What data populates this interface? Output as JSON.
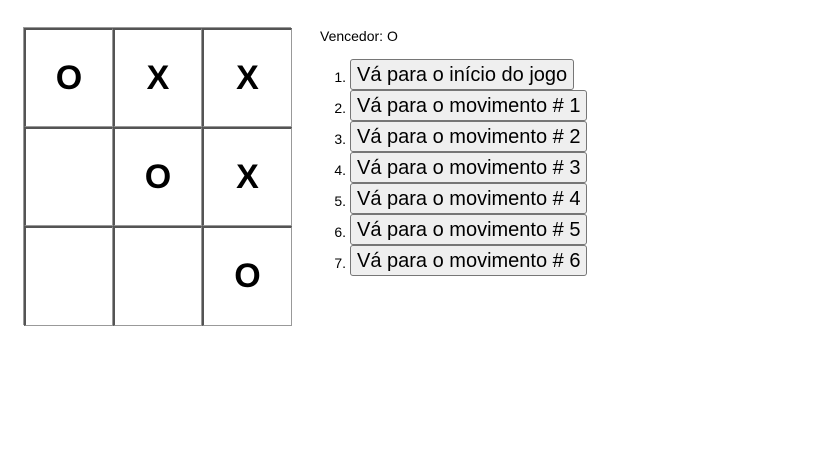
{
  "board": {
    "squares": [
      "O",
      "X",
      "X",
      "",
      "O",
      "X",
      "",
      "",
      "O"
    ]
  },
  "status": "Vencedor: O",
  "moves": [
    {
      "number": "1.",
      "label": "Vá para o início do jogo"
    },
    {
      "number": "2.",
      "label": "Vá para o movimento # 1"
    },
    {
      "number": "3.",
      "label": "Vá para o movimento # 2"
    },
    {
      "number": "4.",
      "label": "Vá para o movimento # 3"
    },
    {
      "number": "5.",
      "label": "Vá para o movimento # 4"
    },
    {
      "number": "6.",
      "label": "Vá para o movimento # 5"
    },
    {
      "number": "7.",
      "label": "Vá para o movimento # 6"
    }
  ]
}
